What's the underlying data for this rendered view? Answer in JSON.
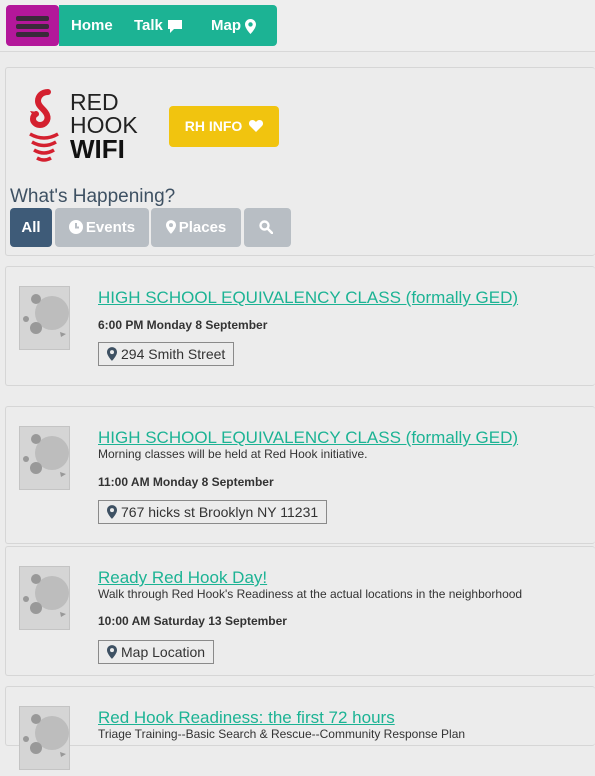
{
  "nav": {
    "home": "Home",
    "talk": "Talk",
    "map": "Map"
  },
  "brand": {
    "logo_text_line1": "RED",
    "logo_text_line2": "HOOK",
    "logo_text_line3": "WIFI",
    "info_button": "RH INFO"
  },
  "section": {
    "heading": "What's Happening?",
    "filters": [
      "All",
      "Events",
      "Places"
    ]
  },
  "events": [
    {
      "title": "HIGH SCHOOL EQUIVALENCY CLASS (formally GED)",
      "description": "",
      "time": "6:00 PM Monday 8 September",
      "location": "294 Smith Street"
    },
    {
      "title": "HIGH SCHOOL EQUIVALENCY CLASS (formally GED)",
      "description": "Morning classes will be held at Red Hook initiative.",
      "time": "11:00 AM Monday 8 September",
      "location": "767 hicks st Brooklyn NY 11231"
    },
    {
      "title": "Ready Red Hook Day!",
      "description": "Walk through Red Hook's Readiness at the actual locations in the neighborhood",
      "time": "10:00 AM Saturday 13 September",
      "location": "Map Location"
    },
    {
      "title": "Red Hook Readiness: the first 72 hours",
      "description": "Triage Training--Basic Search & Rescue--Community Response Plan",
      "time": "",
      "location": ""
    }
  ],
  "colors": {
    "menu": "#b3179a",
    "nav": "#1cb394",
    "info": "#f1c40f",
    "filter_active": "#3e5b78",
    "filter_inactive": "#b8bec4",
    "logo_red": "#d4202f"
  }
}
